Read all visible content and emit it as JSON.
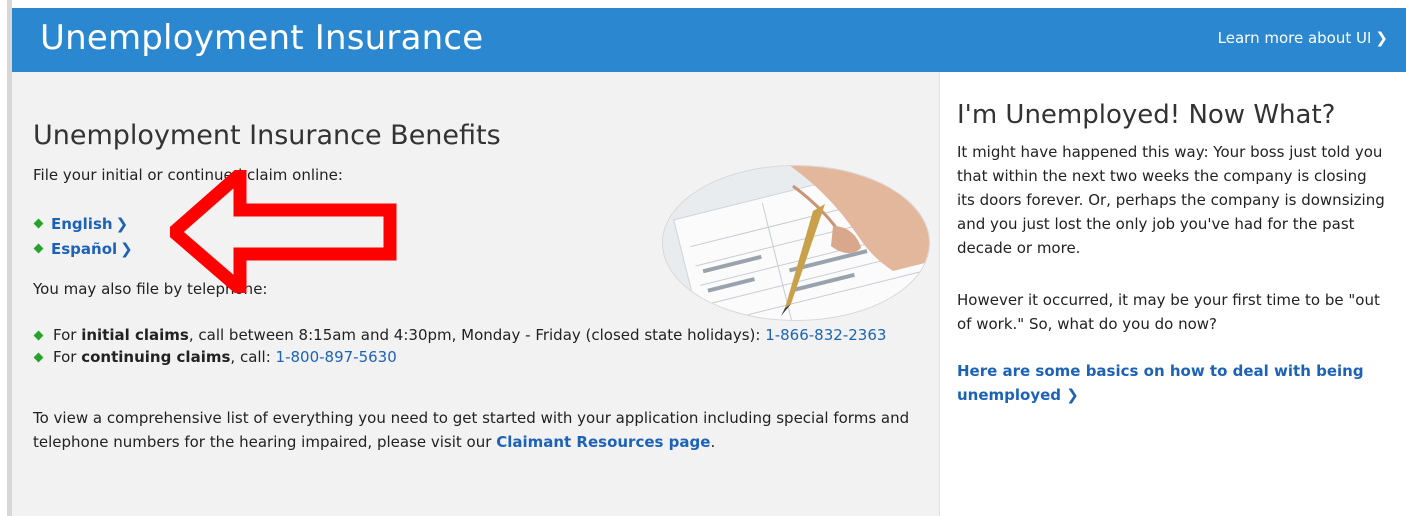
{
  "header": {
    "title": "Unemployment Insurance",
    "learn_more_label": "Learn more about UI",
    "learn_more_chevron": "❯",
    "background_color": "#2a87d0"
  },
  "main": {
    "heading": "Unemployment Insurance Benefits",
    "intro": "File your initial or continued claim online:",
    "languages": [
      {
        "label": "English",
        "chevron": "❯"
      },
      {
        "label": "Español",
        "chevron": "❯"
      }
    ],
    "phone_intro": "You may also file by telephone:",
    "initial_claims": {
      "prefix": "For ",
      "bold": "initial claims",
      "middle": ", call between 8:15am and 4:30pm, Monday - Friday (closed state holidays): ",
      "phone": "1-866-832-2363"
    },
    "continuing_claims": {
      "prefix": "For ",
      "bold": "continuing claims",
      "middle": ", call: ",
      "phone": "1-800-897-5630"
    },
    "resources": {
      "text": "To view a comprehensive list of everything you need to get started with your application including special forms and telephone numbers for the hearing impaired, please visit our ",
      "link": "Claimant Resources page",
      "suffix": "."
    },
    "image_icon": "hand-signing-form-photo"
  },
  "side": {
    "heading": "I'm Unemployed! Now What?",
    "paragraph1": "It might have happened this way: Your boss just told you that within the next two weeks the company is closing its doors forever. Or, perhaps the company is downsizing and you just lost the only job you've had for the past decade or more.",
    "paragraph2": "However it occurred, it may be your first time to be \"out of work.\" So, what do you do now?",
    "basics_link": "Here are some basics on how to deal with being unemployed",
    "basics_chevron": "❯"
  },
  "annotation": {
    "arrow_color": "#ff0000",
    "arrow_icon": "left-arrow-icon"
  },
  "colors": {
    "link": "#1c63b8",
    "bullet": "#27a32a",
    "main_background": "#f2f2f2"
  }
}
